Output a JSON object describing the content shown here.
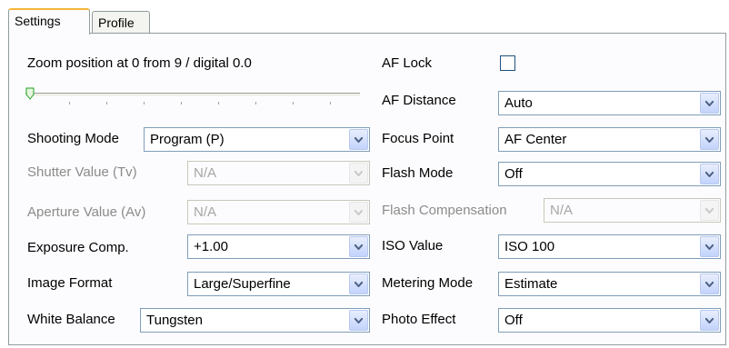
{
  "tabs": [
    {
      "label": "Settings",
      "active": true
    },
    {
      "label": "Profile",
      "active": false
    }
  ],
  "zoom": {
    "text": "Zoom position at 0 from 9 / digital 0.0",
    "position": 0,
    "max": 9
  },
  "left": {
    "shooting_mode": {
      "label": "Shooting Mode",
      "value": "Program (P)",
      "enabled": true
    },
    "shutter_value": {
      "label": "Shutter Value (Tv)",
      "value": "N/A",
      "enabled": false
    },
    "aperture_value": {
      "label": "Aperture Value (Av)",
      "value": "N/A",
      "enabled": false
    },
    "exposure_comp": {
      "label": "Exposure Comp.",
      "value": "+1.00",
      "enabled": true
    },
    "image_format": {
      "label": "Image Format",
      "value": "Large/Superfine",
      "enabled": true
    },
    "white_balance": {
      "label": "White Balance",
      "value": "Tungsten",
      "enabled": true
    }
  },
  "right": {
    "af_lock": {
      "label": "AF Lock",
      "checked": false
    },
    "af_distance": {
      "label": "AF Distance",
      "value": "Auto",
      "enabled": true
    },
    "focus_point": {
      "label": "Focus Point",
      "value": "AF Center",
      "enabled": true
    },
    "flash_mode": {
      "label": "Flash Mode",
      "value": "Off",
      "enabled": true
    },
    "flash_compensation": {
      "label": "Flash Compensation",
      "value": "N/A",
      "enabled": false
    },
    "iso_value": {
      "label": "ISO Value",
      "value": "ISO 100",
      "enabled": true
    },
    "metering_mode": {
      "label": "Metering Mode",
      "value": "Estimate",
      "enabled": true
    },
    "photo_effect": {
      "label": "Photo Effect",
      "value": "Off",
      "enabled": true
    }
  },
  "colors": {
    "tab_highlight": "#f5b53a",
    "combo_border": "#7f9db9",
    "disabled_text": "#8b8b8b",
    "panel_bg": "#fcfcfe"
  },
  "icons": {
    "dropdown": "chevron-down-icon",
    "slider_thumb": "slider-thumb-icon"
  }
}
